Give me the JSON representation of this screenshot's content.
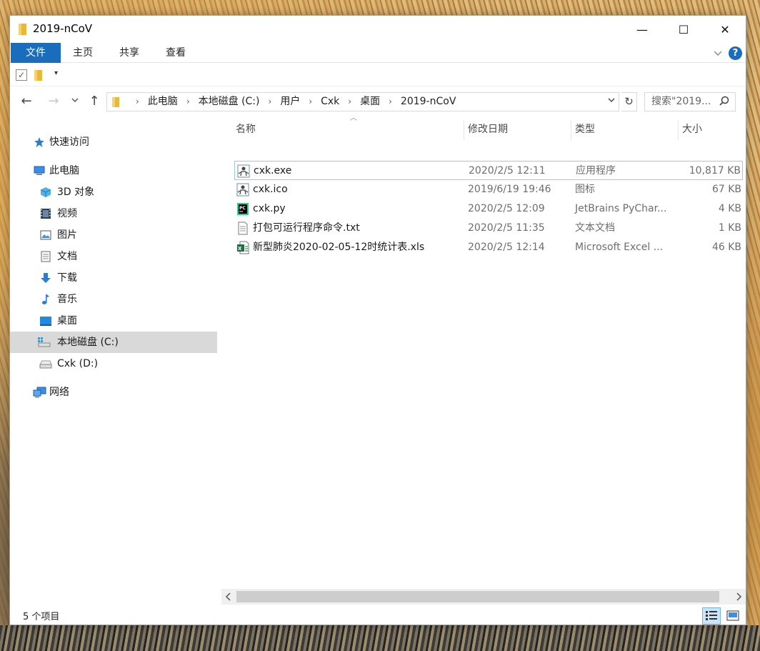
{
  "window": {
    "title": "2019-nCoV",
    "controls": {
      "minimize": "—",
      "maximize": "☐",
      "close": "✕"
    }
  },
  "ribbon": {
    "tabs": [
      "文件",
      "主页",
      "共享",
      "查看"
    ],
    "help": "?"
  },
  "qat": {
    "dropdown": "▾"
  },
  "nav": {
    "back": "←",
    "forward": "→",
    "recent": "⌄",
    "up": "↑",
    "breadcrumbs": [
      "此电脑",
      "本地磁盘 (C:)",
      "用户",
      "Cxk",
      "桌面",
      "2019-nCoV"
    ],
    "separator": "›",
    "search_placeholder": "搜索\"2019...",
    "refresh": "↻"
  },
  "sidebar": {
    "quick_access": "快速访问",
    "this_pc": "此电脑",
    "items": [
      "3D 对象",
      "视频",
      "图片",
      "文档",
      "下载",
      "音乐",
      "桌面",
      "本地磁盘 (C:)",
      "Cxk (D:)"
    ],
    "network": "网络",
    "selected": "本地磁盘 (C:)"
  },
  "columns": {
    "name": "名称",
    "date": "修改日期",
    "type": "类型",
    "size": "大小"
  },
  "files": [
    {
      "name": "cxk.exe",
      "date": "2020/2/5 12:11",
      "type": "应用程序",
      "size": "10,817 KB",
      "icon": "app-icon"
    },
    {
      "name": "cxk.ico",
      "date": "2019/6/19 19:46",
      "type": "图标",
      "size": "67 KB",
      "icon": "ico-icon"
    },
    {
      "name": "cxk.py",
      "date": "2020/2/5 12:09",
      "type": "JetBrains PyChar...",
      "size": "4 KB",
      "icon": "pycharm-icon"
    },
    {
      "name": "打包可运行程序命令.txt",
      "date": "2020/2/5 11:35",
      "type": "文本文档",
      "size": "1 KB",
      "icon": "text-file-icon"
    },
    {
      "name": "新型肺炎2020-02-05-12时统计表.xls",
      "date": "2020/2/5 12:14",
      "type": "Microsoft Excel ...",
      "size": "46 KB",
      "icon": "excel-icon"
    }
  ],
  "status": {
    "count": "5 个项目"
  },
  "colors": {
    "accent": "#1a6dbd",
    "selected": "#d9d9d9",
    "hover_border": "#99c9ef"
  }
}
